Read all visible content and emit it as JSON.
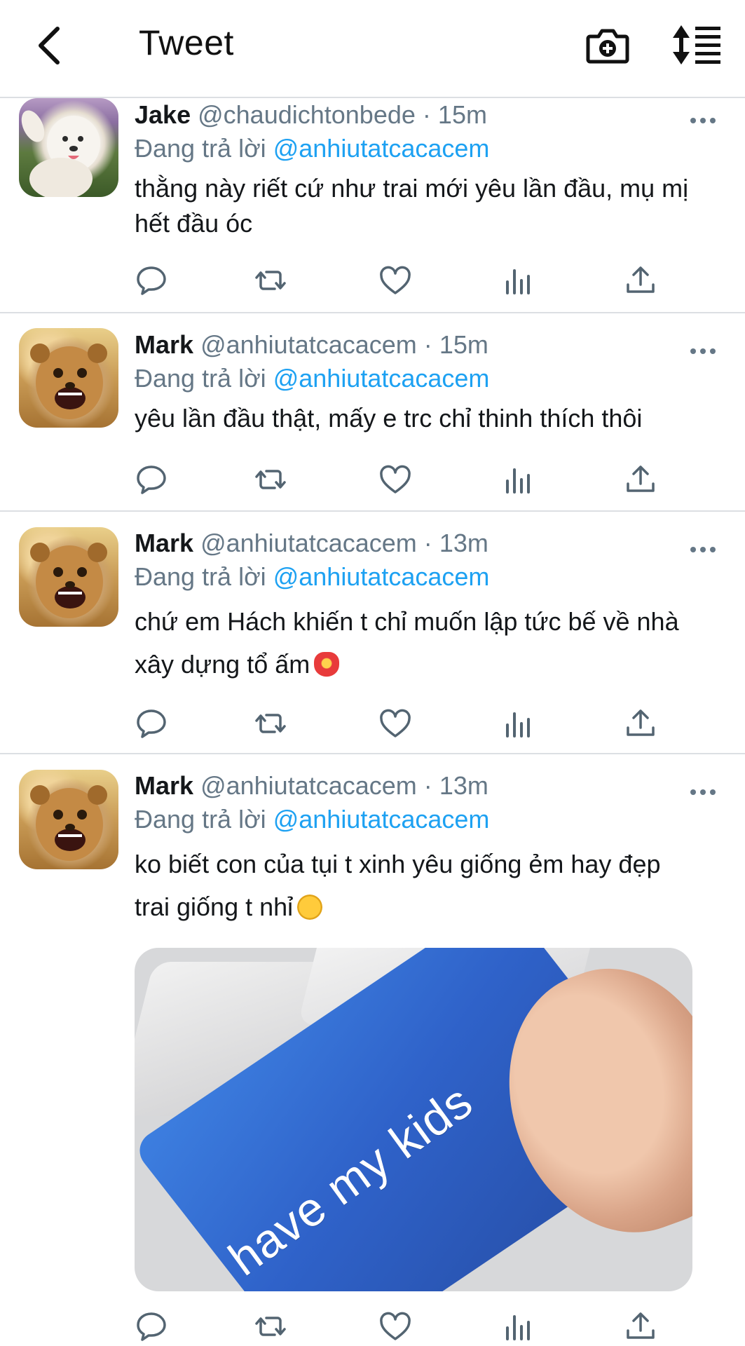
{
  "header": {
    "title": "Tweet",
    "back_icon": "chevron-left-icon",
    "camera_icon": "camera-plus-icon",
    "sort_icon": "sort-list-icon"
  },
  "colors": {
    "mention": "#1da1f2",
    "secondary_text": "#657786",
    "primary_text": "#14171a",
    "divider": "#dcdfe3"
  },
  "tweets": [
    {
      "name": "Jake",
      "handle": "@chaudichtonbede",
      "separator": "·",
      "time": "15m",
      "replying_prefix": "Đang trả lời",
      "replying_to": "@anhiutatcacacem",
      "text": "thằng này riết cứ như trai mới yêu lần đầu, mụ mị hết đầu óc",
      "avatar": "dog-avatar"
    },
    {
      "name": "Mark",
      "handle": "@anhiutatcacacem",
      "separator": "·",
      "time": "15m",
      "replying_prefix": "Đang trả lời",
      "replying_to": "@anhiutatcacacem",
      "text": "yêu lần đầu thật, mấy e trc chỉ thinh thích thôi",
      "avatar": "cheetah-avatar"
    },
    {
      "name": "Mark",
      "handle": "@anhiutatcacacem",
      "separator": "·",
      "time": "13m",
      "replying_prefix": "Đang trả lời",
      "replying_to": "@anhiutatcacacem",
      "text": "chứ em Hách khiến t chỉ muốn lập tức bế về nhà xây dựng tổ ấm",
      "emoji": "heart-on-fire-emoji",
      "avatar": "cheetah-avatar"
    },
    {
      "name": "Mark",
      "handle": "@anhiutatcacacem",
      "separator": "·",
      "time": "13m",
      "replying_prefix": "Đang trả lời",
      "replying_to": "@anhiutatcacacem",
      "text": "ko biết con của tụi t xinh yêu giống ẻm hay đẹp trai giống t nhỉ",
      "emoji": "star-struck-emoji",
      "avatar": "cheetah-avatar",
      "media_caption": "have my kids"
    }
  ],
  "action_icons": [
    "reply-icon",
    "retweet-icon",
    "like-icon",
    "analytics-icon",
    "share-icon"
  ]
}
